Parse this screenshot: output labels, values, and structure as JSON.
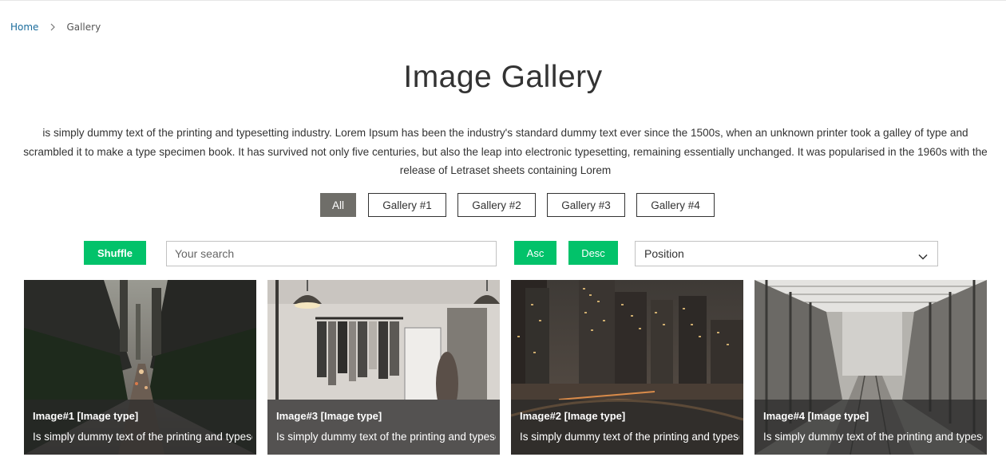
{
  "breadcrumb": {
    "home": "Home",
    "current": "Gallery"
  },
  "page": {
    "title": "Image Gallery",
    "description": "is simply dummy text of the printing and typesetting industry. Lorem Ipsum has been the industry's standard dummy text ever since the 1500s, when an unknown printer took a galley of type and scrambled it to make a type specimen book. It has survived not only five centuries, but also the leap into electronic typesetting, remaining essentially unchanged. It was popularised in the 1960s with the release of Letraset sheets containing Lorem"
  },
  "filters": [
    "All",
    "Gallery #1",
    "Gallery #2",
    "Gallery #3",
    "Gallery #4"
  ],
  "active_filter": "All",
  "controls": {
    "shuffle_label": "Shuffle",
    "search_placeholder": "Your search",
    "asc_label": "Asc",
    "desc_label": "Desc",
    "sort_selected": "Position"
  },
  "cards": [
    {
      "title": "Image#1 [Image type]",
      "text": "Is simply dummy text of the printing and typesetting industry.",
      "scene": "city-street"
    },
    {
      "title": "Image#3 [Image type]",
      "text": "Is simply dummy text of the printing and typesetting industry.",
      "scene": "clothing-store"
    },
    {
      "title": "Image#2 [Image type]",
      "text": "Is simply dummy text of the printing and typesetting industry.",
      "scene": "city-night"
    },
    {
      "title": "Image#4 [Image type]",
      "text": "Is simply dummy text of the printing and typesetting industry.",
      "scene": "factory-hall"
    }
  ],
  "colors": {
    "accent_green": "#02c26a",
    "active_filter_bg": "#6f6e69",
    "link_blue": "#1a6c9c"
  },
  "icons": {
    "breadcrumb_separator": "chevron-right-icon",
    "select_arrow": "chevron-down-icon"
  }
}
